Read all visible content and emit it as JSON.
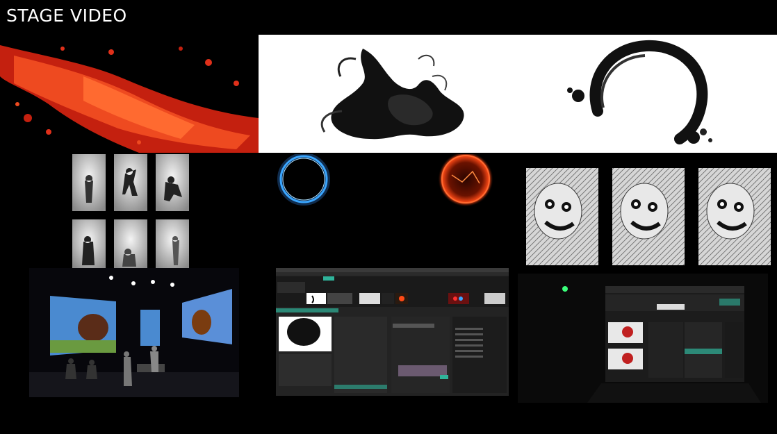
{
  "page": {
    "title": "STAGE VIDEO"
  },
  "colors": {
    "background": "#000000",
    "paint_red": "#e0301a",
    "glow_blue": "#3aa6ff",
    "glow_orange": "#ff4a16",
    "ui_teal": "#2fb39a"
  },
  "tiles": [
    {
      "name": "red-paint-splash"
    },
    {
      "name": "ink-smoke-cloud"
    },
    {
      "name": "ink-brush-ring"
    },
    {
      "name": "shadow-silhouette-grid"
    },
    {
      "name": "glowing-orbs"
    },
    {
      "name": "scribble-face-triptych"
    },
    {
      "name": "stage-projection-photo"
    },
    {
      "name": "vj-software-screenshot"
    },
    {
      "name": "laptop-vj-setup-photo"
    }
  ]
}
